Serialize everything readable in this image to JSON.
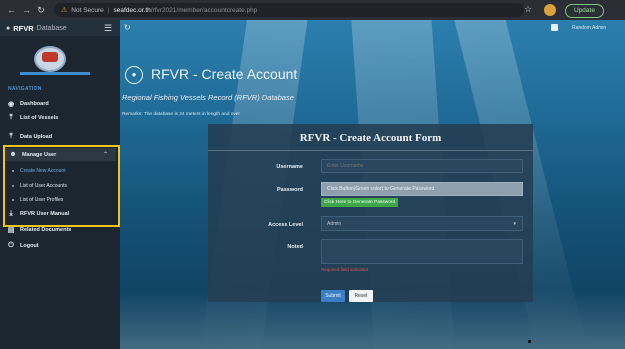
{
  "browser": {
    "security_label": "Not Secure",
    "url_host": "seafdec.or.th",
    "url_path": "/rfvr2021/member/accountcreate.php",
    "update_label": "Update"
  },
  "sidebar": {
    "brand_bold": "RFVR",
    "brand_light": "Database",
    "nav_label": "NAVIGATION",
    "items": [
      {
        "label": "Dashboard",
        "icon": "dashboard-icon"
      },
      {
        "label": "List of Vessels",
        "icon": "upload-icon"
      },
      {
        "label": "Data Upload",
        "icon": "upload-icon"
      },
      {
        "label": "Manage User",
        "icon": "users-icon"
      },
      {
        "label": "RFVR User Manual",
        "icon": "download-icon"
      },
      {
        "label": "Related Documents",
        "icon": "document-icon"
      },
      {
        "label": "Logout",
        "icon": "power-icon"
      }
    ],
    "manage_user_subitems": [
      {
        "label": "Create New Account",
        "active": true
      },
      {
        "label": "List of User Accounts",
        "active": false
      },
      {
        "label": "List of User Profiles",
        "active": false
      }
    ]
  },
  "header": {
    "user_name": "Random Admin"
  },
  "page": {
    "title": "RFVR - Create Account",
    "subtitle": "Regional Fishing Vessels Record (RFVR) Database",
    "remarks": "Remarks: The database is 24 meters in length and over"
  },
  "form": {
    "title": "RFVR - Create Account Form",
    "username_label": "Username",
    "username_placeholder": "Enter Username",
    "password_label": "Password",
    "password_placeholder": "Click Button(Green color) to Generate Password",
    "generate_button": "Click Here to Generate Password",
    "access_level_label": "Access Level",
    "access_level_value": "Admin",
    "noted_label": "Noted",
    "required_note": "Required field indicated",
    "submit_label": "Submit",
    "reset_label": "Reset"
  },
  "colors": {
    "highlight_box": "#f3c41c",
    "generate_button": "#3fa64a",
    "submit_button": "#3c7fc4"
  }
}
